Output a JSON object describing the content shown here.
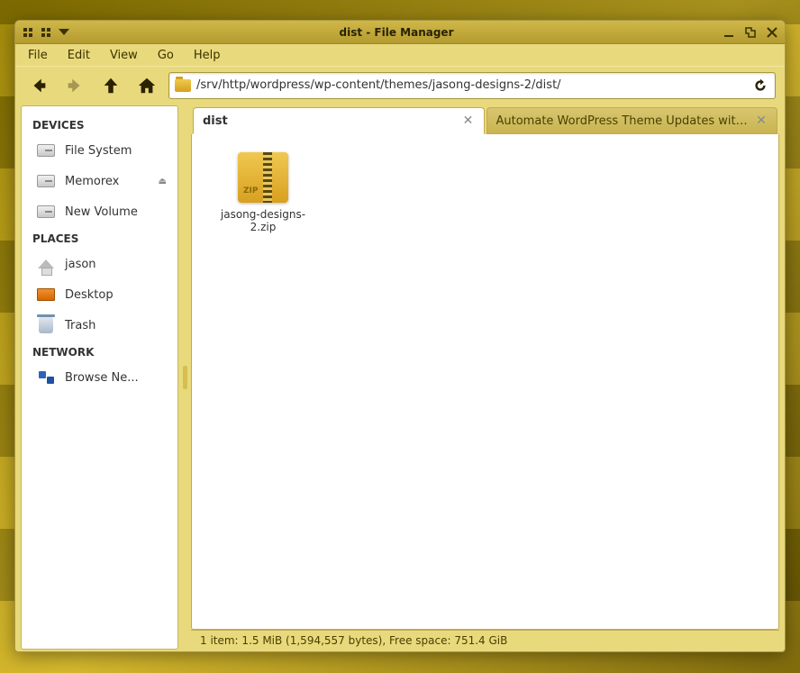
{
  "window": {
    "title": "dist - File Manager"
  },
  "menubar": [
    "File",
    "Edit",
    "View",
    "Go",
    "Help"
  ],
  "path": "/srv/http/wordpress/wp-content/themes/jasong-designs-2/dist/",
  "sidebar": {
    "sections": [
      {
        "header": "DEVICES",
        "items": [
          {
            "label": "File System",
            "icon": "drive",
            "ejectable": false
          },
          {
            "label": "Memorex",
            "icon": "drive",
            "ejectable": true
          },
          {
            "label": "New Volume",
            "icon": "drive",
            "ejectable": false
          }
        ]
      },
      {
        "header": "PLACES",
        "items": [
          {
            "label": "jason",
            "icon": "home",
            "ejectable": false
          },
          {
            "label": "Desktop",
            "icon": "desktop",
            "ejectable": false
          },
          {
            "label": "Trash",
            "icon": "trash",
            "ejectable": false
          }
        ]
      },
      {
        "header": "NETWORK",
        "items": [
          {
            "label": "Browse Ne...",
            "icon": "network",
            "ejectable": false
          }
        ]
      }
    ]
  },
  "tabs": [
    {
      "label": "dist",
      "active": true
    },
    {
      "label": "Automate WordPress Theme Updates with...",
      "active": false
    }
  ],
  "files": [
    {
      "name": "jasong-designs-2.zip",
      "type": "zip",
      "zip_badge": "ZIP"
    }
  ],
  "statusbar": "1 item: 1.5 MiB (1,594,557 bytes), Free space: 751.4 GiB"
}
